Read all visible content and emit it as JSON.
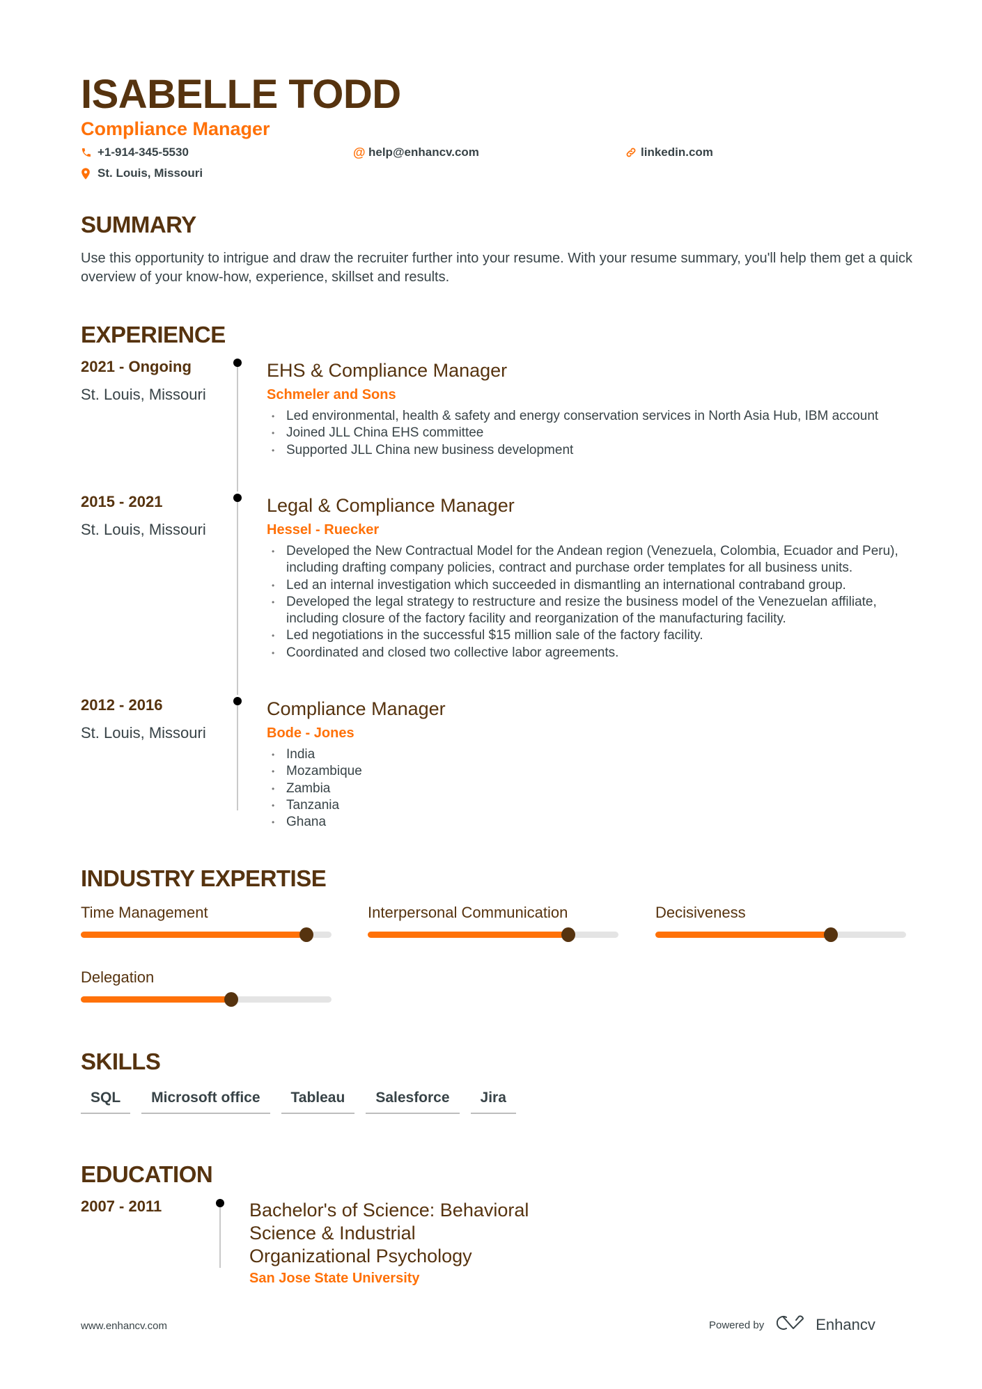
{
  "header": {
    "name": "ISABELLE TODD",
    "role": "Compliance Manager",
    "contacts": {
      "phone": {
        "icon": "phone-icon",
        "value": "+1-914-345-5530"
      },
      "email": {
        "icon": "at-icon",
        "value": "help@enhancv.com"
      },
      "linkedin": {
        "icon": "link-icon",
        "value": "linkedin.com"
      },
      "location": {
        "icon": "location-pin-icon",
        "value": "St. Louis, Missouri"
      }
    }
  },
  "colors": {
    "heading": "#56330f",
    "accent": "#ff7108",
    "text": "#384347"
  },
  "summary": {
    "title": "SUMMARY",
    "text": "Use this opportunity to intrigue and draw the recruiter further into your resume. With your resume summary, you'll help them get a quick overview of your know-how, experience, skillset and results."
  },
  "experience": {
    "title": "EXPERIENCE",
    "items": [
      {
        "dates": "2021 - Ongoing",
        "location": "St. Louis, Missouri",
        "title": "EHS & Compliance Manager",
        "company": "Schmeler and Sons",
        "bullets": [
          "Led environmental, health & safety and energy conservation services in North Asia Hub, IBM account",
          "Joined JLL China EHS committee",
          "Supported JLL China new business development"
        ]
      },
      {
        "dates": "2015 - 2021",
        "location": "St. Louis, Missouri",
        "title": "Legal & Compliance Manager",
        "company": "Hessel - Ruecker",
        "bullets": [
          "Developed the New Contractual Model for the Andean region (Venezuela, Colombia, Ecuador and Peru), including drafting company policies, contract and purchase order templates for all business units.",
          "Led an internal investigation which succeeded in dismantling an international contraband group.",
          "Developed the legal strategy to restructure and resize the business model of the Venezuelan affiliate, including closure of the factory facility and reorganization of the manufacturing facility.",
          "Led negotiations in the successful $15 million sale of the factory facility.",
          "Coordinated and closed two collective labor agreements."
        ]
      },
      {
        "dates": "2012 - 2016",
        "location": "St. Louis, Missouri",
        "title": "Compliance Manager",
        "company": "Bode - Jones",
        "bullets": [
          "India",
          "Mozambique",
          "Zambia",
          "Tanzania",
          "Ghana"
        ]
      }
    ]
  },
  "expertise": {
    "title": "INDUSTRY EXPERTISE",
    "items": [
      {
        "label": "Time Management",
        "level": 0.9
      },
      {
        "label": "Interpersonal Communication",
        "level": 0.8
      },
      {
        "label": "Decisiveness",
        "level": 0.7
      },
      {
        "label": "Delegation",
        "level": 0.6
      }
    ]
  },
  "skills": {
    "title": "SKILLS",
    "items": [
      "SQL",
      "Microsoft office",
      "Tableau",
      "Salesforce",
      "Jira"
    ]
  },
  "education": {
    "title": "EDUCATION",
    "items": [
      {
        "dates": "2007 - 2011",
        "degree": "Bachelor's of Science: Behavioral Science & Industrial Organizational Psychology",
        "school": "San Jose State University"
      }
    ]
  },
  "footer": {
    "website": "www.enhancv.com",
    "powered_by": "Powered by",
    "brand": "Enhancv",
    "brand_icon": "enhancv-logo-icon"
  }
}
